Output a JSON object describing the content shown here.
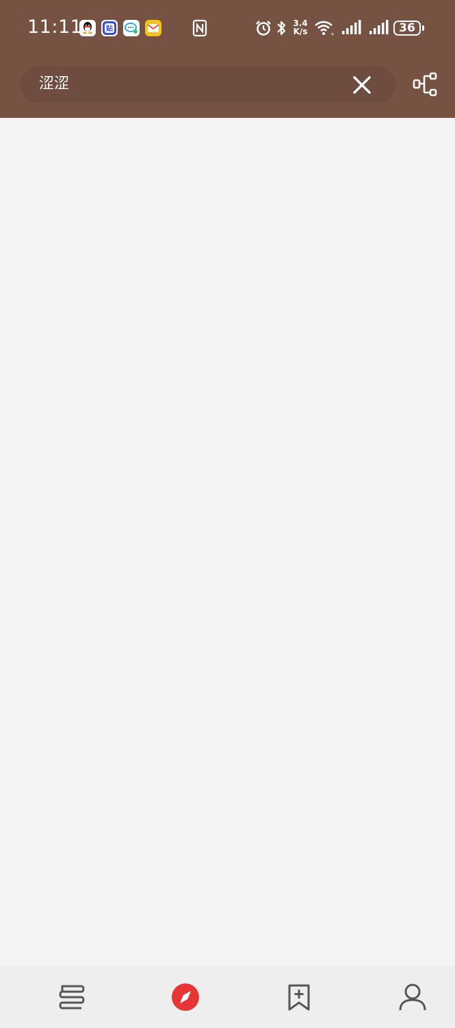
{
  "status_bar": {
    "time": "11:11",
    "notification_icons": [
      "qq-icon",
      "tieba-icon",
      "messages-icon",
      "mail-icon"
    ],
    "system_icons": [
      "nfc-icon",
      "alarm-icon",
      "bluetooth-icon",
      "wifi-icon",
      "signal-icon",
      "signal-icon"
    ],
    "net_speed_value": "3.4",
    "net_speed_unit": "K/s",
    "battery_level": "36"
  },
  "search": {
    "query": "涩涩"
  },
  "toolbar": {
    "clear_icon": "close-icon",
    "share_icon": "share-nodes-icon"
  },
  "bottom_nav": {
    "items": [
      {
        "icon": "bookshelf-icon",
        "active": false
      },
      {
        "icon": "compass-icon",
        "active": true
      },
      {
        "icon": "bookmark-add-icon",
        "active": false
      },
      {
        "icon": "user-icon",
        "active": false
      }
    ]
  },
  "colors": {
    "app_bar": "#765243",
    "search_field": "#6e4d40",
    "content_bg": "#f4f4f4",
    "nav_bg": "#eeeeee",
    "accent": "#e63535",
    "nav_icon": "#555555"
  }
}
